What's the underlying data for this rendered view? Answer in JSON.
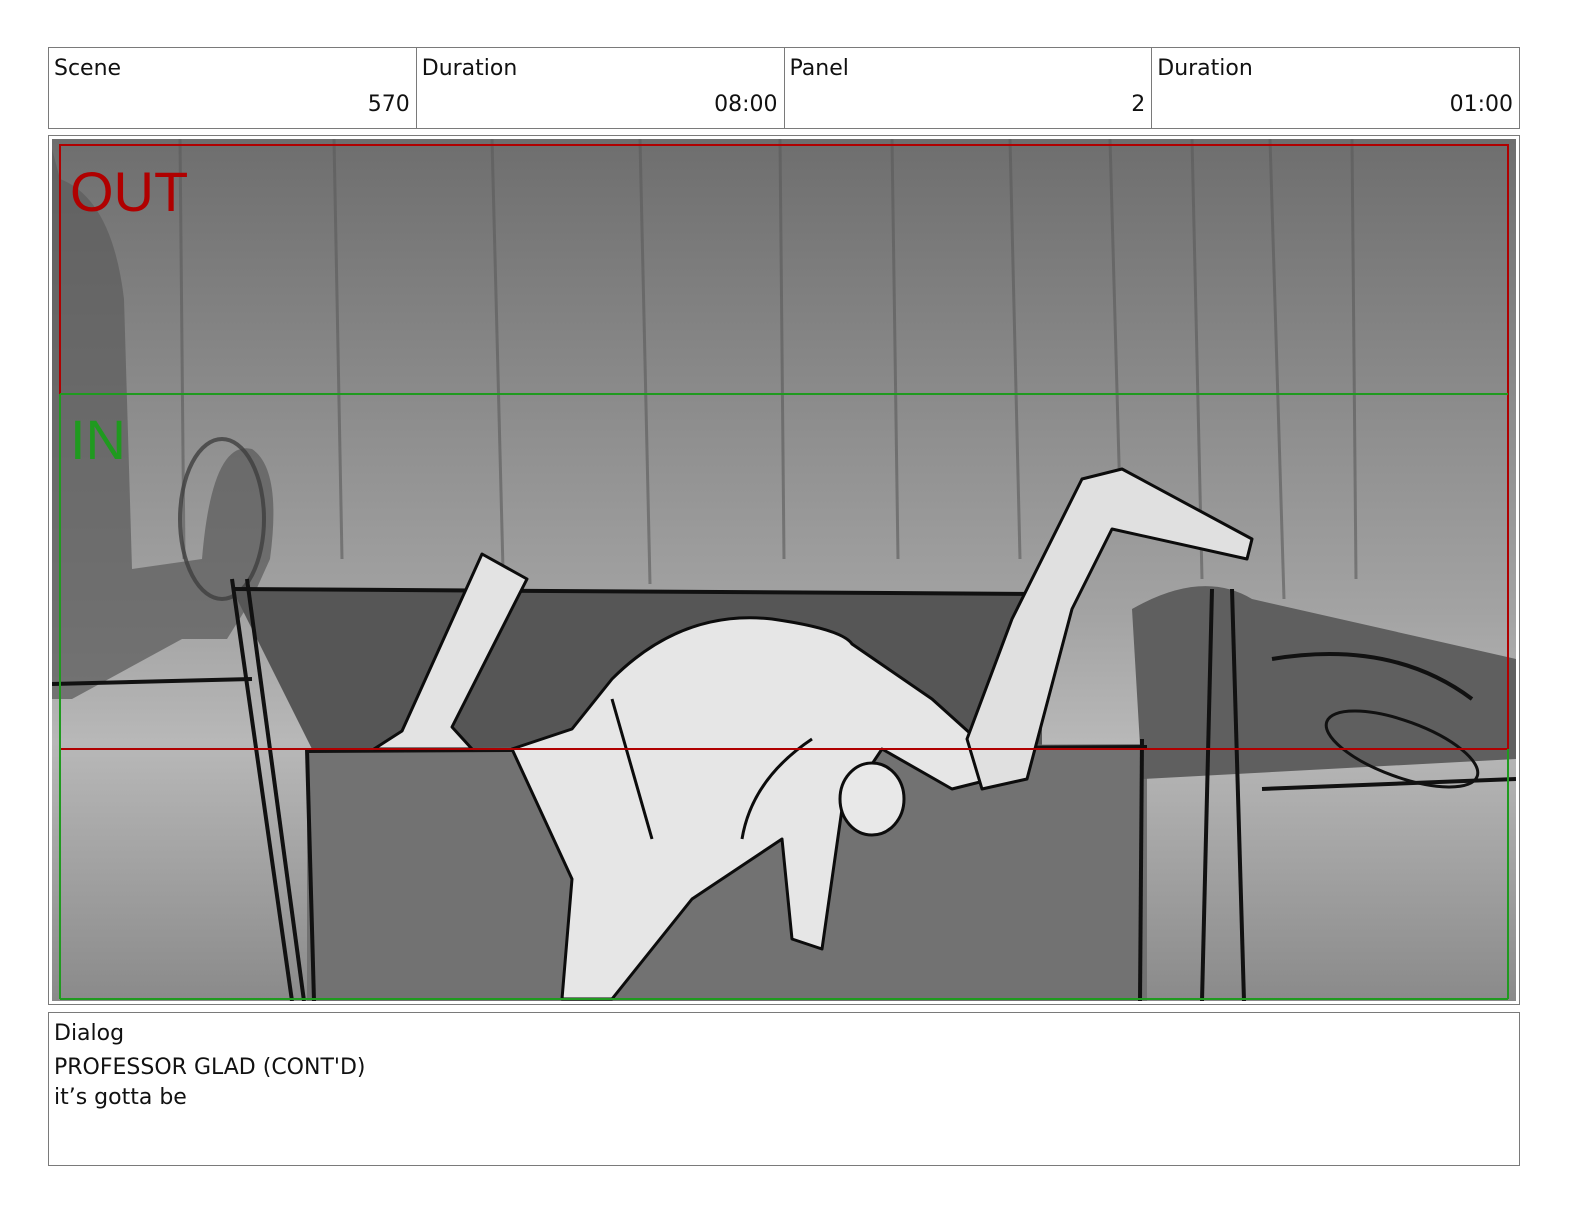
{
  "header": {
    "scene_label": "Scene",
    "scene_value": "570",
    "scene_duration_label": "Duration",
    "scene_duration_value": "08:00",
    "panel_label": "Panel",
    "panel_value": "2",
    "panel_duration_label": "Duration",
    "panel_duration_value": "01:00"
  },
  "panel": {
    "out_label": "OUT",
    "in_label": "IN",
    "out_color": "#b00000",
    "in_color": "#1f9a1f"
  },
  "dialog": {
    "label": "Dialog",
    "character": "PROFESSOR GLAD (CONT'D)",
    "line": "it’s gotta be"
  }
}
